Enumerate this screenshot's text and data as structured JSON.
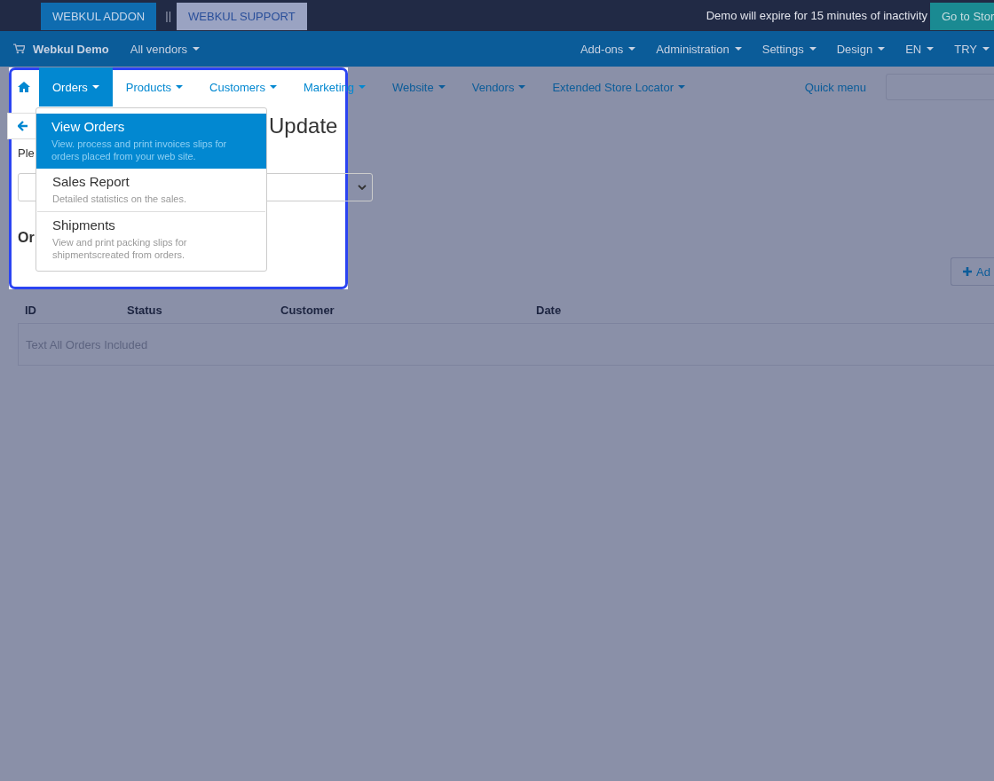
{
  "top_bar": {
    "buttons": [
      {
        "label": "WEBKUL ADDON",
        "kind": "primary"
      },
      {
        "label": "WEBKUL SUPPORT",
        "kind": "light"
      }
    ],
    "separator": "||",
    "notice": "Demo will expire for 15 minutes of inactivity",
    "store_button": "Go to Stor"
  },
  "admin_bar": {
    "brand": "Webkul Demo",
    "vendor_select": "All vendors",
    "menus": [
      "Add-ons",
      "Administration",
      "Settings",
      "Design",
      "EN",
      "TRY"
    ]
  },
  "main_nav": {
    "items": [
      {
        "label": "Orders",
        "selected": true
      },
      {
        "label": "Products",
        "selected": false
      },
      {
        "label": "Customers",
        "selected": false
      },
      {
        "label": "Marketing",
        "selected": false
      },
      {
        "label": "Website",
        "selected": false
      },
      {
        "label": "Vendors",
        "selected": false
      },
      {
        "label": "Extended Store Locator",
        "selected": false
      }
    ],
    "quick_menu": "Quick menu"
  },
  "dropdown": {
    "items": [
      {
        "title": "View Orders",
        "description": "View. process and print invoices slips for orders placed from your web site.",
        "selected": true
      },
      {
        "title": "Sales Report",
        "description": "Detailed statistics on the sales.",
        "selected": false
      },
      {
        "title": "Shipments",
        "description": "View and print packing slips for shipmentscreated from orders.",
        "selected": false
      }
    ]
  },
  "page": {
    "title": "Update",
    "hint": "Ple",
    "section_heading": "Or",
    "add_button": "Ad",
    "table": {
      "columns": [
        "ID",
        "Status",
        "Customer",
        "Date"
      ],
      "empty_text": "Text All Orders Included"
    }
  }
}
